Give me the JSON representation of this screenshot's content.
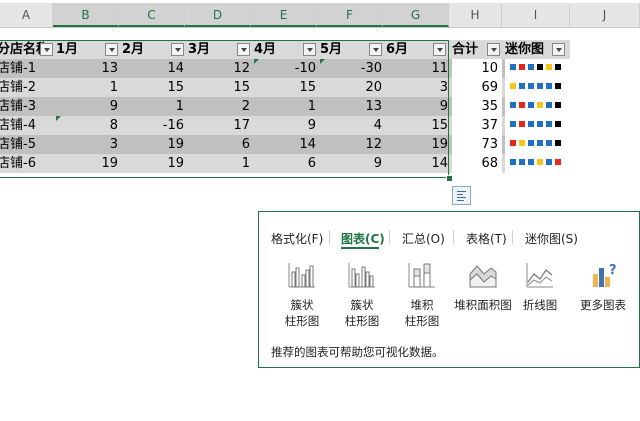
{
  "columns": [
    "A",
    "B",
    "C",
    "D",
    "E",
    "F",
    "G",
    "H",
    "I",
    "J"
  ],
  "header": {
    "store": "分店名称",
    "months": [
      "1月",
      "2月",
      "3月",
      "4月",
      "5月",
      "6月"
    ],
    "total": "合计",
    "mini": "迷你图"
  },
  "rows": [
    {
      "store": "店铺-1",
      "values": [
        "13",
        "14",
        "12",
        "-10",
        "-30",
        "11"
      ],
      "total": "10",
      "spark": [
        "#1f6fc4",
        "#e8251c",
        "#1f6fc4",
        "#000000",
        "#f5c518",
        "#000000"
      ]
    },
    {
      "store": "店铺-2",
      "values": [
        "1",
        "15",
        "15",
        "15",
        "20",
        "3"
      ],
      "total": "69",
      "spark": [
        "#f5c518",
        "#1f6fc4",
        "#1f6fc4",
        "#1f6fc4",
        "#1f6fc4",
        "#000000"
      ]
    },
    {
      "store": "店铺-3",
      "values": [
        "9",
        "1",
        "2",
        "1",
        "13",
        "9"
      ],
      "total": "35",
      "spark": [
        "#1f6fc4",
        "#e8251c",
        "#1f6fc4",
        "#f5c518",
        "#1f6fc4",
        "#000000"
      ]
    },
    {
      "store": "店铺-4",
      "values": [
        "8",
        "-16",
        "17",
        "9",
        "4",
        "15"
      ],
      "total": "37",
      "spark": [
        "#1f6fc4",
        "#e8251c",
        "#1f6fc4",
        "#1f6fc4",
        "#1f6fc4",
        "#000000"
      ]
    },
    {
      "store": "店铺-5",
      "values": [
        "3",
        "19",
        "6",
        "14",
        "12",
        "19"
      ],
      "total": "73",
      "spark": [
        "#e8251c",
        "#f5c518",
        "#1f6fc4",
        "#1f6fc4",
        "#1f6fc4",
        "#000000"
      ]
    },
    {
      "store": "店铺-6",
      "values": [
        "19",
        "19",
        "1",
        "6",
        "9",
        "14"
      ],
      "total": "68",
      "spark": [
        "#1f6fc4",
        "#1f6fc4",
        "#1f6fc4",
        "#f5c518",
        "#1f6fc4",
        "#e8251c"
      ]
    }
  ],
  "quick_analysis": {
    "tabs": [
      "格式化(F)",
      "图表(C)",
      "汇总(O)",
      "表格(T)",
      "迷你图(S)"
    ],
    "active_tab": "图表(C)",
    "options": [
      {
        "label_line1": "簇状",
        "label_line2": "柱形图",
        "icon": "clustered-column-chart-icon"
      },
      {
        "label_line1": "簇状",
        "label_line2": "柱形图",
        "icon": "clustered-column-chart-icon"
      },
      {
        "label_line1": "堆积",
        "label_line2": "柱形图",
        "icon": "stacked-column-chart-icon"
      },
      {
        "label_line1": "堆积面积图",
        "label_line2": "",
        "icon": "stacked-area-chart-icon"
      },
      {
        "label_line1": "折线图",
        "label_line2": "",
        "icon": "line-chart-icon"
      },
      {
        "label_line1": "更多图表",
        "label_line2": "",
        "icon": "more-charts-icon"
      }
    ],
    "footer": "推荐的图表可帮助您可视化数据。"
  },
  "colors": {
    "accent": "#217346",
    "row_dark": "#c0c0c0",
    "row_light": "#d9d9d9",
    "header_bg": "#d9d9d9"
  }
}
